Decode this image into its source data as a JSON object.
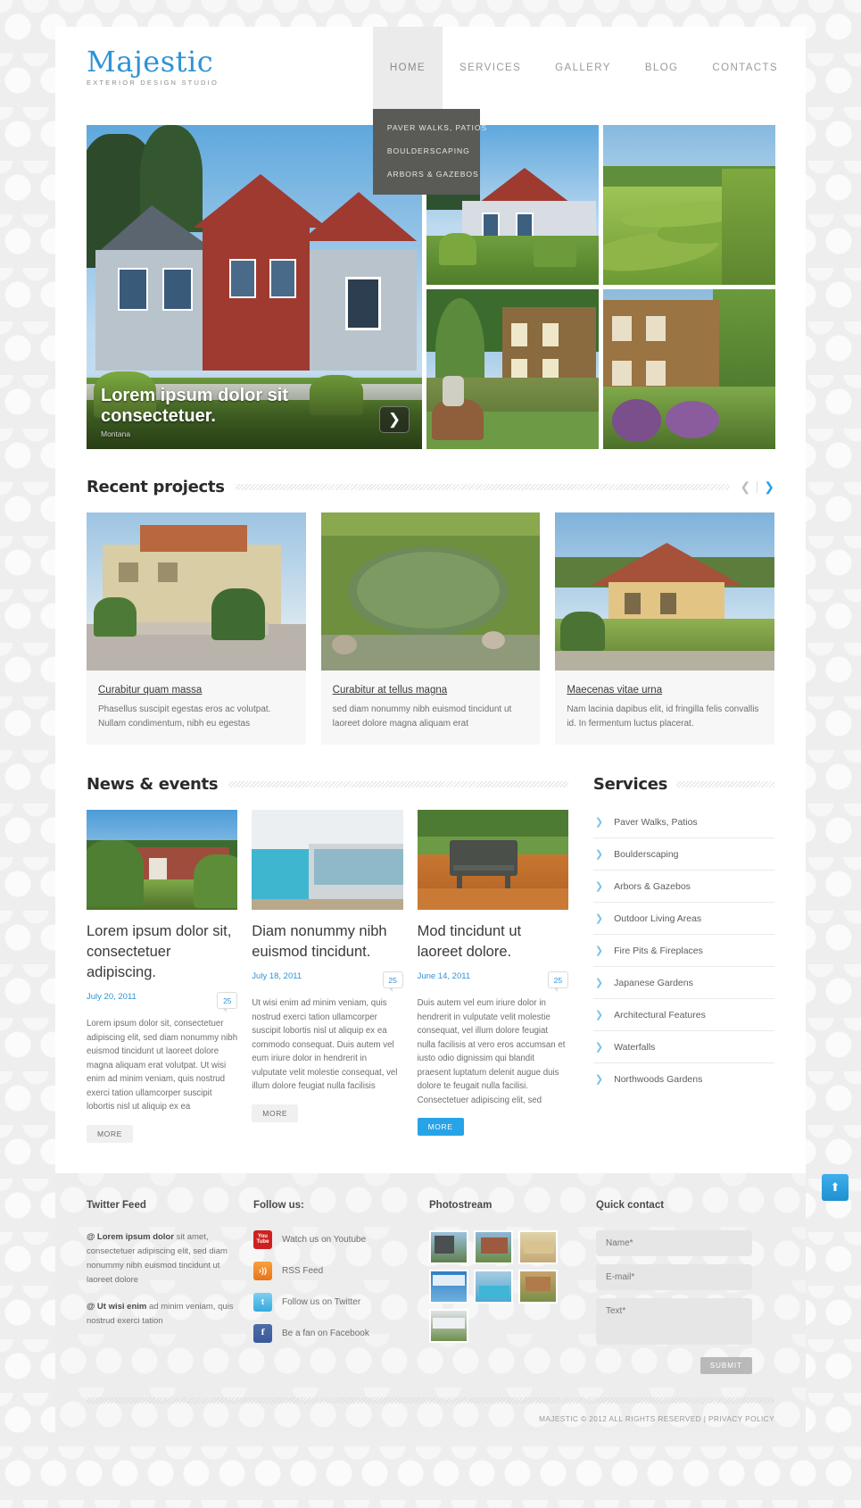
{
  "brand": {
    "name": "Majestic",
    "tagline": "EXTERIOR DESIGN STUDIO",
    "accent": "#2f93d4"
  },
  "nav": {
    "items": [
      {
        "label": "HOME",
        "active": true
      },
      {
        "label": "SERVICES",
        "active": false
      },
      {
        "label": "GALLERY",
        "active": false
      },
      {
        "label": "BLOG",
        "active": false
      },
      {
        "label": "CONTACTS",
        "active": false
      }
    ],
    "dropdown": [
      "PAVER WALKS, PATIOS",
      "BOULDERSCAPING",
      "ARBORS & GAZEBOS"
    ]
  },
  "hero": {
    "title": "Lorem ipsum dolor sit consectetuer.",
    "subtitle": "Montana",
    "next_icon": "chevron-right-icon"
  },
  "recent": {
    "heading": "Recent projects",
    "prev_icon": "chevron-left-icon",
    "next_icon": "chevron-right-icon",
    "items": [
      {
        "link": "Curabitur quam massa",
        "text": "Phasellus suscipit egestas eros ac volutpat. Nullam condimentum, nibh eu egestas"
      },
      {
        "link": "Curabitur at tellus magna",
        "text": "sed diam nonummy nibh euismod tincidunt ut laoreet dolore magna aliquam erat"
      },
      {
        "link": "Maecenas vitae urna",
        "text": "Nam lacinia dapibus elit, id fringilla felis convallis id. In fermentum luctus placerat."
      }
    ]
  },
  "news": {
    "heading": "News & events",
    "items": [
      {
        "title": "Lorem ipsum dolor sit, consectetuer adipiscing.",
        "date": "July 20, 2011",
        "comments": "25",
        "text": "Lorem ipsum dolor sit, consectetuer adipiscing elit, sed diam nonummy nibh euismod tincidunt ut laoreet dolore magna aliquam erat volutpat. Ut wisi enim ad minim veniam, quis nostrud exerci tation ullamcorper suscipit lobortis nisl ut aliquip ex ea",
        "more": "MORE",
        "more_style": "grey"
      },
      {
        "title": "Diam nonummy nibh euismod tincidunt.",
        "date": "July 18, 2011",
        "comments": "25",
        "text": "Ut wisi enim ad minim veniam, quis nostrud exerci tation ullamcorper suscipit lobortis nisl ut aliquip ex ea commodo consequat. Duis autem vel eum iriure dolor in hendrerit in vulputate velit molestie consequat, vel illum dolore feugiat nulla facilisis",
        "more": "MORE",
        "more_style": "grey"
      },
      {
        "title": "Mod tincidunt ut laoreet dolore.",
        "date": "June 14, 2011",
        "comments": "25",
        "text": "Duis autem vel eum iriure dolor in hendrerit in vulputate velit molestie consequat, vel illum dolore feugiat nulla facilisis at vero eros accumsan et iusto odio dignissim qui blandit praesent luptatum delenit augue duis dolore te feugait nulla facilisi. Consectetuer adipiscing elit, sed",
        "more": "MORE",
        "more_style": "blue"
      }
    ]
  },
  "services": {
    "heading": "Services",
    "items": [
      "Paver Walks, Patios",
      "Boulderscaping",
      "Arbors & Gazebos",
      "Outdoor Living Areas",
      "Fire Pits & Fireplaces",
      "Japanese Gardens",
      "Architectural Features",
      "Waterfalls",
      "Northwoods Gardens"
    ]
  },
  "footer": {
    "twitter": {
      "title": "Twitter Feed",
      "tweets": [
        {
          "handle": "@ Lorem ipsum dolor",
          "text": " sit amet, consectetuer adipiscing elit, sed diam nonummy nibh euismod tincidunt ut laoreet dolore"
        },
        {
          "handle": "@ Ut wisi enim",
          "text": " ad minim veniam, quis nostrud exerci tation"
        }
      ]
    },
    "follow": {
      "title": "Follow us:",
      "items": [
        {
          "label": "Watch us on Youtube",
          "icon": "youtube-icon",
          "glyph": "You\nTube"
        },
        {
          "label": "RSS Feed",
          "icon": "rss-icon",
          "glyph": "»"
        },
        {
          "label": "Follow us on Twitter",
          "icon": "twitter-icon",
          "glyph": "t"
        },
        {
          "label": "Be a fan on Facebook",
          "icon": "facebook-icon",
          "glyph": "f"
        }
      ]
    },
    "photostream": {
      "title": "Photostream",
      "count": 7
    },
    "contact": {
      "title": "Quick contact",
      "name_placeholder": "Name*",
      "email_placeholder": "E-mail*",
      "text_placeholder": "Text*",
      "submit_label": "SUBMIT"
    },
    "copyright": "MAJESTIC © 2012 ALL RIGHTS RESERVED   |   PRIVACY POLICY",
    "to_top_icon": "arrow-up-icon"
  }
}
